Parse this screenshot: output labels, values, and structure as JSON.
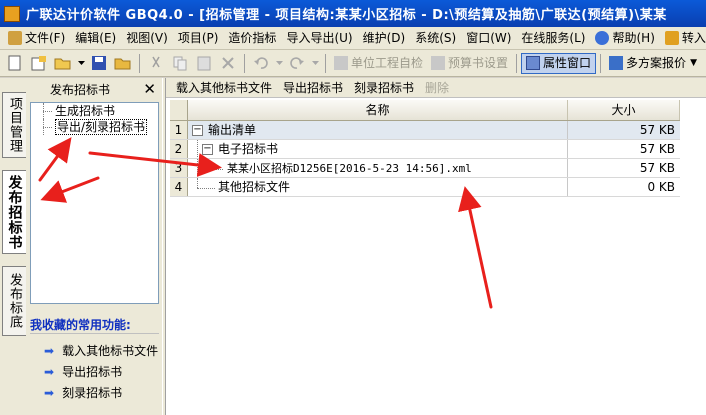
{
  "window": {
    "title": "广联达计价软件 GBQ4.0 - [招标管理 - 项目结构:某某小区招标 - D:\\预结算及抽筋\\广联达(预结算)\\某某"
  },
  "menu": {
    "items": [
      "文件(F)",
      "编辑(E)",
      "视图(V)",
      "项目(P)",
      "造价指标",
      "导入导出(U)",
      "维护(D)",
      "系统(S)",
      "窗口(W)",
      "在线服务(L)",
      "帮助(H)",
      "转入"
    ]
  },
  "toolbar": {
    "unit_check": "单位工程自检",
    "estimate_settings": "预算书设置",
    "property_window": "属性窗口",
    "multi_quote": "多方案报价"
  },
  "vertical_tabs": [
    "项目管理",
    "发布招标书",
    "发布标底"
  ],
  "left_panel": {
    "title": "发布招标书",
    "tree": [
      "生成招标书",
      "导出/刻录招标书"
    ],
    "favorites_title": "我收藏的常用功能:",
    "favorites": [
      "载入其他标书文件",
      "导出招标书",
      "刻录招标书"
    ]
  },
  "right_panel": {
    "actions": {
      "load_other": "载入其他标书文件",
      "export": "导出招标书",
      "burn": "刻录招标书",
      "delete": "删除"
    },
    "columns": {
      "name": "名称",
      "size": "大小"
    },
    "rows": [
      {
        "num": "1",
        "name": "输出清单",
        "size": "57 KB"
      },
      {
        "num": "2",
        "name": "电子招标书",
        "size": "57 KB"
      },
      {
        "num": "3",
        "name": "某某小区招标D1256E[2016-5-23  14:56].xml",
        "size": "57 KB"
      },
      {
        "num": "4",
        "name": "其他招标文件",
        "size": "0 KB"
      }
    ]
  },
  "annotation_color": "#e8201c"
}
